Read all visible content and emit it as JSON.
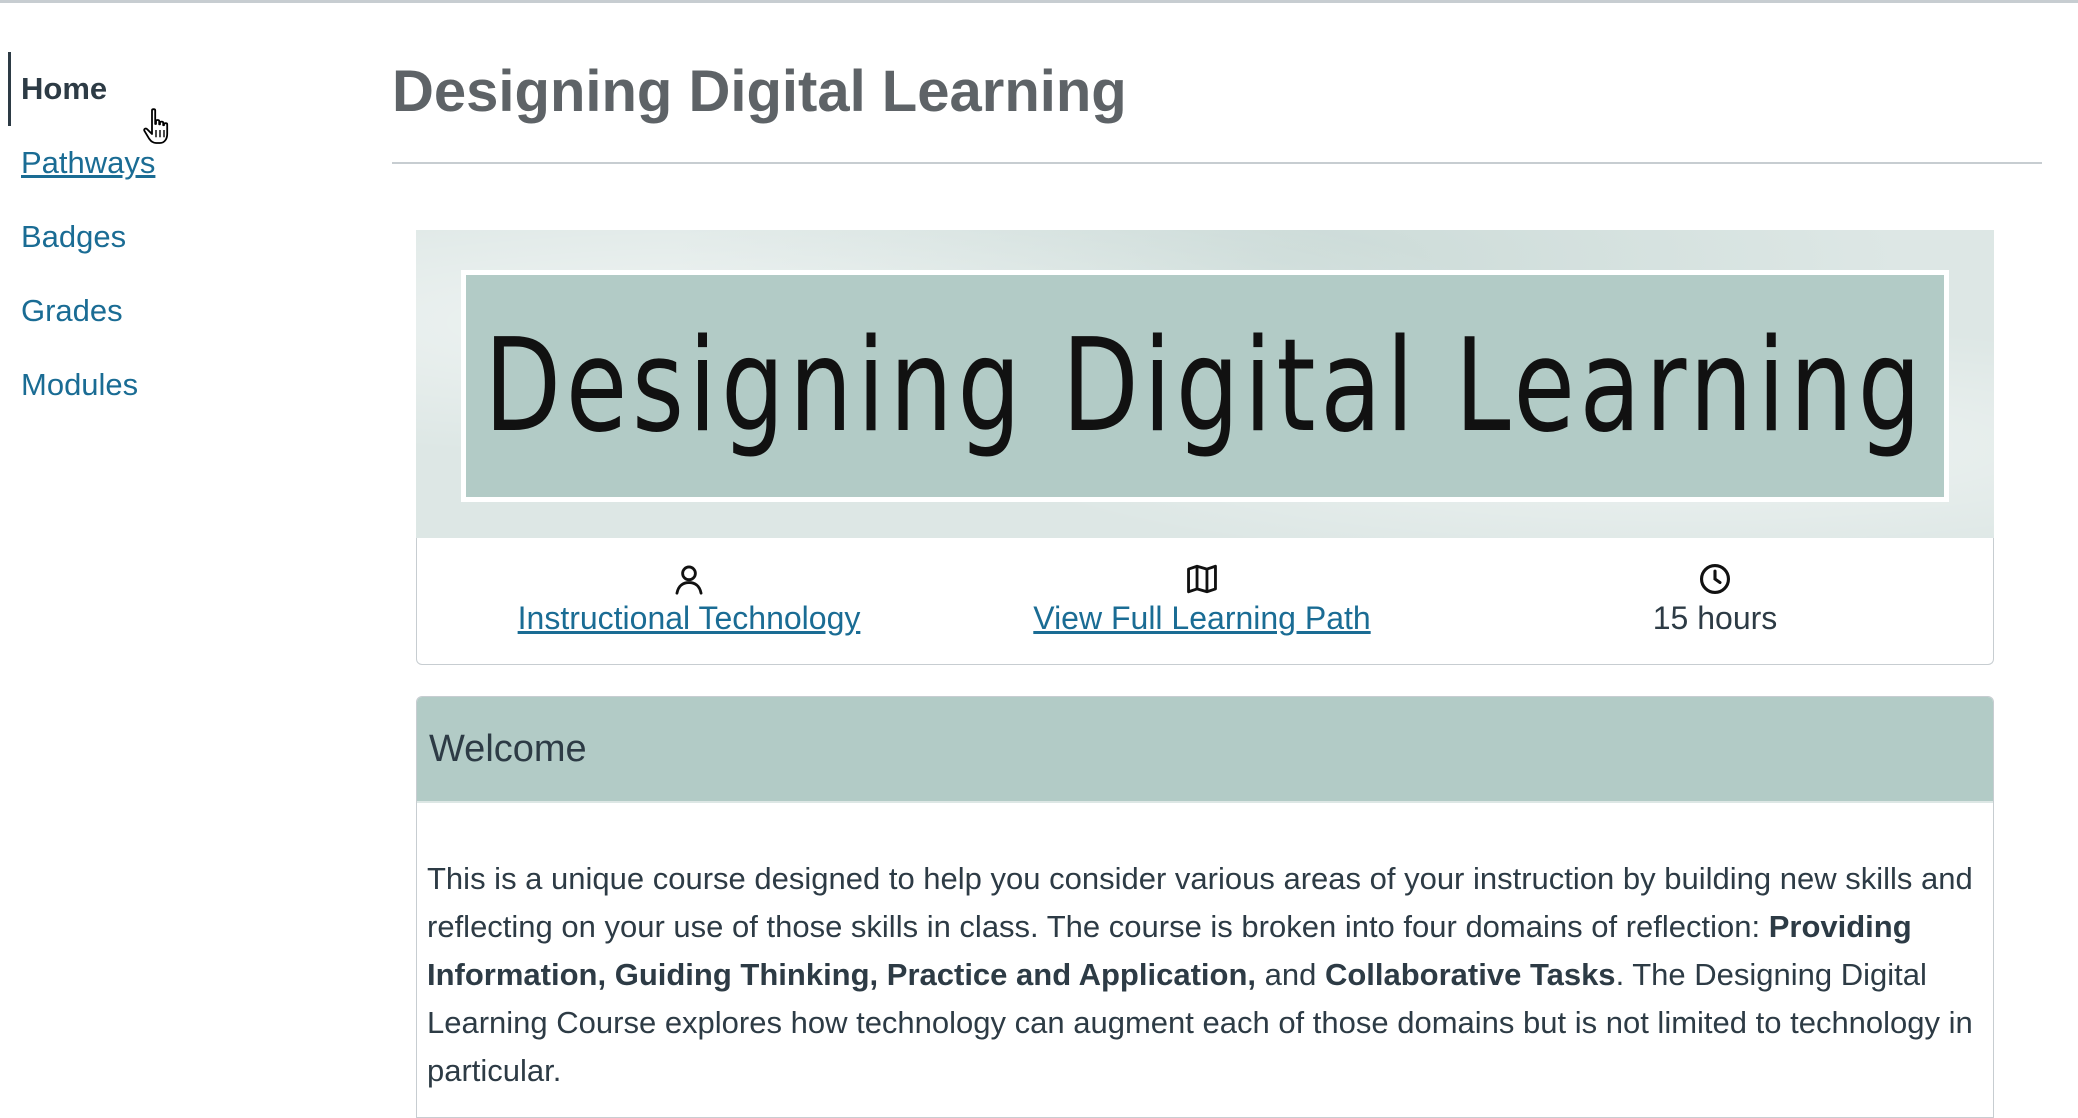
{
  "sidebar": {
    "items": [
      {
        "label": "Home",
        "active": true
      },
      {
        "label": "Pathways"
      },
      {
        "label": "Badges"
      },
      {
        "label": "Grades"
      },
      {
        "label": "Modules"
      }
    ]
  },
  "page": {
    "title": "Designing Digital Learning"
  },
  "banner": {
    "text": "Designing Digital Learning"
  },
  "info_bar": {
    "category": {
      "icon": "user-icon",
      "label": "Instructional Technology"
    },
    "path": {
      "icon": "map-icon",
      "label": "View Full Learning Path"
    },
    "duration": {
      "icon": "clock-icon",
      "label": "15 hours"
    }
  },
  "welcome": {
    "heading": "Welcome",
    "p1": "This is a unique course designed to help you consider various areas of your instruction by building new skills and reflecting on your use of those skills in class. The course is broken into four domains of reflection: ",
    "bold1": "Providing Information, Guiding Thinking, Practice and Application,",
    "and": " and ",
    "bold2": "Collaborative Tasks",
    "p2": ". The Designing Digital Learning Course explores how technology can augment each of those domains but is not limited to technology in particular."
  },
  "colors": {
    "link": "#1a6c94",
    "text": "#2d3b45",
    "accent_teal": "#b2cbc6",
    "title_gray": "#5e6367"
  }
}
